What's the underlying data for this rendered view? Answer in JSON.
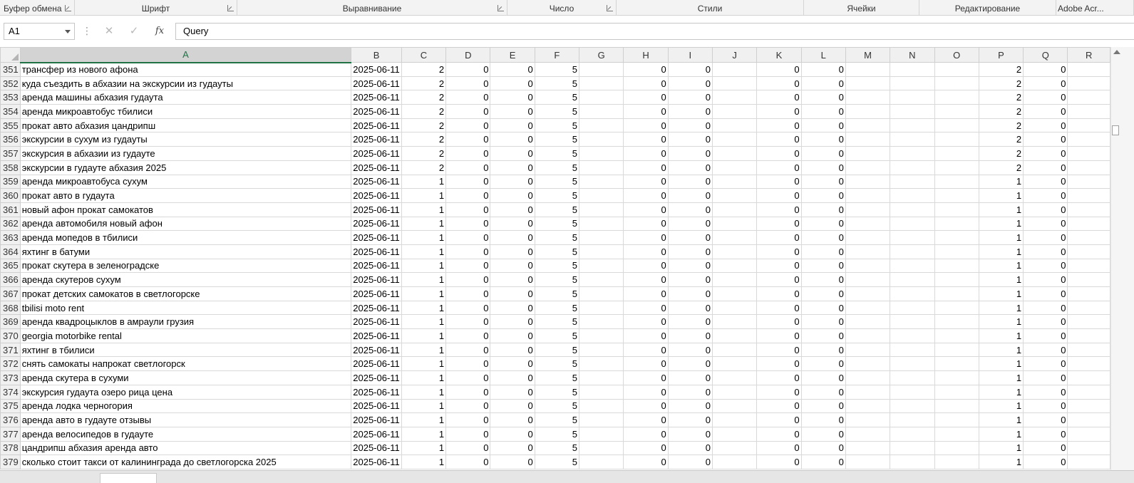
{
  "ribbon": {
    "groups": [
      {
        "label": "Буфер обмена",
        "launcher": true
      },
      {
        "label": "Шрифт",
        "launcher": true
      },
      {
        "label": "Выравнивание",
        "launcher": true
      },
      {
        "label": "Число",
        "launcher": true
      },
      {
        "label": "Стили",
        "launcher": false
      },
      {
        "label": "Ячейки",
        "launcher": false
      },
      {
        "label": "Редактирование",
        "launcher": false
      },
      {
        "label": "Adobe Acr...",
        "launcher": false
      }
    ]
  },
  "formula_bar": {
    "name_box": "A1",
    "cancel_icon": "✕",
    "enter_icon": "✓",
    "fx_label": "fx",
    "content": "Query"
  },
  "columns": [
    "A",
    "B",
    "C",
    "D",
    "E",
    "F",
    "G",
    "H",
    "I",
    "J",
    "K",
    "L",
    "M",
    "N",
    "O",
    "P",
    "Q",
    "R"
  ],
  "rows": [
    {
      "n": "351",
      "a": "трансфер из нового афона",
      "b": "2025-06-11",
      "c": "2",
      "d": "0",
      "e": "0",
      "f": "5",
      "g": "",
      "h": "0",
      "i": "0",
      "j": "",
      "k": "0",
      "l": "0",
      "m": "",
      "nn": "",
      "o": "",
      "p": "2",
      "q": "0",
      "r": ""
    },
    {
      "n": "352",
      "a": "куда съездить в абхазии на экскурсии из гудауты",
      "b": "2025-06-11",
      "c": "2",
      "d": "0",
      "e": "0",
      "f": "5",
      "g": "",
      "h": "0",
      "i": "0",
      "j": "",
      "k": "0",
      "l": "0",
      "m": "",
      "nn": "",
      "o": "",
      "p": "2",
      "q": "0",
      "r": ""
    },
    {
      "n": "353",
      "a": "аренда машины абхазия гудаута",
      "b": "2025-06-11",
      "c": "2",
      "d": "0",
      "e": "0",
      "f": "5",
      "g": "",
      "h": "0",
      "i": "0",
      "j": "",
      "k": "0",
      "l": "0",
      "m": "",
      "nn": "",
      "o": "",
      "p": "2",
      "q": "0",
      "r": ""
    },
    {
      "n": "354",
      "a": "аренда микроавтобус тбилиси",
      "b": "2025-06-11",
      "c": "2",
      "d": "0",
      "e": "0",
      "f": "5",
      "g": "",
      "h": "0",
      "i": "0",
      "j": "",
      "k": "0",
      "l": "0",
      "m": "",
      "nn": "",
      "o": "",
      "p": "2",
      "q": "0",
      "r": ""
    },
    {
      "n": "355",
      "a": "прокат авто абхазия цандрипш",
      "b": "2025-06-11",
      "c": "2",
      "d": "0",
      "e": "0",
      "f": "5",
      "g": "",
      "h": "0",
      "i": "0",
      "j": "",
      "k": "0",
      "l": "0",
      "m": "",
      "nn": "",
      "o": "",
      "p": "2",
      "q": "0",
      "r": ""
    },
    {
      "n": "356",
      "a": "экскурсии в сухум из гудауты",
      "b": "2025-06-11",
      "c": "2",
      "d": "0",
      "e": "0",
      "f": "5",
      "g": "",
      "h": "0",
      "i": "0",
      "j": "",
      "k": "0",
      "l": "0",
      "m": "",
      "nn": "",
      "o": "",
      "p": "2",
      "q": "0",
      "r": ""
    },
    {
      "n": "357",
      "a": "экскурсия в абхазии из гудауте",
      "b": "2025-06-11",
      "c": "2",
      "d": "0",
      "e": "0",
      "f": "5",
      "g": "",
      "h": "0",
      "i": "0",
      "j": "",
      "k": "0",
      "l": "0",
      "m": "",
      "nn": "",
      "o": "",
      "p": "2",
      "q": "0",
      "r": ""
    },
    {
      "n": "358",
      "a": "экскурсии в гудауте абхазия 2025",
      "b": "2025-06-11",
      "c": "2",
      "d": "0",
      "e": "0",
      "f": "5",
      "g": "",
      "h": "0",
      "i": "0",
      "j": "",
      "k": "0",
      "l": "0",
      "m": "",
      "nn": "",
      "o": "",
      "p": "2",
      "q": "0",
      "r": ""
    },
    {
      "n": "359",
      "a": "аренда микроавтобуса сухум",
      "b": "2025-06-11",
      "c": "1",
      "d": "0",
      "e": "0",
      "f": "5",
      "g": "",
      "h": "0",
      "i": "0",
      "j": "",
      "k": "0",
      "l": "0",
      "m": "",
      "nn": "",
      "o": "",
      "p": "1",
      "q": "0",
      "r": ""
    },
    {
      "n": "360",
      "a": "прокат авто в гудаута",
      "b": "2025-06-11",
      "c": "1",
      "d": "0",
      "e": "0",
      "f": "5",
      "g": "",
      "h": "0",
      "i": "0",
      "j": "",
      "k": "0",
      "l": "0",
      "m": "",
      "nn": "",
      "o": "",
      "p": "1",
      "q": "0",
      "r": ""
    },
    {
      "n": "361",
      "a": "новый афон прокат самокатов",
      "b": "2025-06-11",
      "c": "1",
      "d": "0",
      "e": "0",
      "f": "5",
      "g": "",
      "h": "0",
      "i": "0",
      "j": "",
      "k": "0",
      "l": "0",
      "m": "",
      "nn": "",
      "o": "",
      "p": "1",
      "q": "0",
      "r": ""
    },
    {
      "n": "362",
      "a": "аренда автомобиля новый афон",
      "b": "2025-06-11",
      "c": "1",
      "d": "0",
      "e": "0",
      "f": "5",
      "g": "",
      "h": "0",
      "i": "0",
      "j": "",
      "k": "0",
      "l": "0",
      "m": "",
      "nn": "",
      "o": "",
      "p": "1",
      "q": "0",
      "r": ""
    },
    {
      "n": "363",
      "a": "аренда мопедов в тбилиси",
      "b": "2025-06-11",
      "c": "1",
      "d": "0",
      "e": "0",
      "f": "5",
      "g": "",
      "h": "0",
      "i": "0",
      "j": "",
      "k": "0",
      "l": "0",
      "m": "",
      "nn": "",
      "o": "",
      "p": "1",
      "q": "0",
      "r": ""
    },
    {
      "n": "364",
      "a": "яхтинг в батуми",
      "b": "2025-06-11",
      "c": "1",
      "d": "0",
      "e": "0",
      "f": "5",
      "g": "",
      "h": "0",
      "i": "0",
      "j": "",
      "k": "0",
      "l": "0",
      "m": "",
      "nn": "",
      "o": "",
      "p": "1",
      "q": "0",
      "r": ""
    },
    {
      "n": "365",
      "a": "прокат скутера в зеленоградске",
      "b": "2025-06-11",
      "c": "1",
      "d": "0",
      "e": "0",
      "f": "5",
      "g": "",
      "h": "0",
      "i": "0",
      "j": "",
      "k": "0",
      "l": "0",
      "m": "",
      "nn": "",
      "o": "",
      "p": "1",
      "q": "0",
      "r": ""
    },
    {
      "n": "366",
      "a": "аренда скутеров сухум",
      "b": "2025-06-11",
      "c": "1",
      "d": "0",
      "e": "0",
      "f": "5",
      "g": "",
      "h": "0",
      "i": "0",
      "j": "",
      "k": "0",
      "l": "0",
      "m": "",
      "nn": "",
      "o": "",
      "p": "1",
      "q": "0",
      "r": ""
    },
    {
      "n": "367",
      "a": "прокат детских самокатов в светлогорске",
      "b": "2025-06-11",
      "c": "1",
      "d": "0",
      "e": "0",
      "f": "5",
      "g": "",
      "h": "0",
      "i": "0",
      "j": "",
      "k": "0",
      "l": "0",
      "m": "",
      "nn": "",
      "o": "",
      "p": "1",
      "q": "0",
      "r": ""
    },
    {
      "n": "368",
      "a": "tbilisi moto rent",
      "b": "2025-06-11",
      "c": "1",
      "d": "0",
      "e": "0",
      "f": "5",
      "g": "",
      "h": "0",
      "i": "0",
      "j": "",
      "k": "0",
      "l": "0",
      "m": "",
      "nn": "",
      "o": "",
      "p": "1",
      "q": "0",
      "r": ""
    },
    {
      "n": "369",
      "a": "аренда квадроцыклов в амраули грузия",
      "b": "2025-06-11",
      "c": "1",
      "d": "0",
      "e": "0",
      "f": "5",
      "g": "",
      "h": "0",
      "i": "0",
      "j": "",
      "k": "0",
      "l": "0",
      "m": "",
      "nn": "",
      "o": "",
      "p": "1",
      "q": "0",
      "r": ""
    },
    {
      "n": "370",
      "a": "georgia motorbike rental",
      "b": "2025-06-11",
      "c": "1",
      "d": "0",
      "e": "0",
      "f": "5",
      "g": "",
      "h": "0",
      "i": "0",
      "j": "",
      "k": "0",
      "l": "0",
      "m": "",
      "nn": "",
      "o": "",
      "p": "1",
      "q": "0",
      "r": ""
    },
    {
      "n": "371",
      "a": "яхтинг в тбилиси",
      "b": "2025-06-11",
      "c": "1",
      "d": "0",
      "e": "0",
      "f": "5",
      "g": "",
      "h": "0",
      "i": "0",
      "j": "",
      "k": "0",
      "l": "0",
      "m": "",
      "nn": "",
      "o": "",
      "p": "1",
      "q": "0",
      "r": ""
    },
    {
      "n": "372",
      "a": "снять самокаты напрокат светлогорск",
      "b": "2025-06-11",
      "c": "1",
      "d": "0",
      "e": "0",
      "f": "5",
      "g": "",
      "h": "0",
      "i": "0",
      "j": "",
      "k": "0",
      "l": "0",
      "m": "",
      "nn": "",
      "o": "",
      "p": "1",
      "q": "0",
      "r": ""
    },
    {
      "n": "373",
      "a": "аренда скутера в сухуми",
      "b": "2025-06-11",
      "c": "1",
      "d": "0",
      "e": "0",
      "f": "5",
      "g": "",
      "h": "0",
      "i": "0",
      "j": "",
      "k": "0",
      "l": "0",
      "m": "",
      "nn": "",
      "o": "",
      "p": "1",
      "q": "0",
      "r": ""
    },
    {
      "n": "374",
      "a": "экскурсия гудаута озеро рица цена",
      "b": "2025-06-11",
      "c": "1",
      "d": "0",
      "e": "0",
      "f": "5",
      "g": "",
      "h": "0",
      "i": "0",
      "j": "",
      "k": "0",
      "l": "0",
      "m": "",
      "nn": "",
      "o": "",
      "p": "1",
      "q": "0",
      "r": ""
    },
    {
      "n": "375",
      "a": "аренда лодка черногория",
      "b": "2025-06-11",
      "c": "1",
      "d": "0",
      "e": "0",
      "f": "5",
      "g": "",
      "h": "0",
      "i": "0",
      "j": "",
      "k": "0",
      "l": "0",
      "m": "",
      "nn": "",
      "o": "",
      "p": "1",
      "q": "0",
      "r": ""
    },
    {
      "n": "376",
      "a": "аренда авто в гудауте отзывы",
      "b": "2025-06-11",
      "c": "1",
      "d": "0",
      "e": "0",
      "f": "5",
      "g": "",
      "h": "0",
      "i": "0",
      "j": "",
      "k": "0",
      "l": "0",
      "m": "",
      "nn": "",
      "o": "",
      "p": "1",
      "q": "0",
      "r": ""
    },
    {
      "n": "377",
      "a": "аренда велосипедов в гудауте",
      "b": "2025-06-11",
      "c": "1",
      "d": "0",
      "e": "0",
      "f": "5",
      "g": "",
      "h": "0",
      "i": "0",
      "j": "",
      "k": "0",
      "l": "0",
      "m": "",
      "nn": "",
      "o": "",
      "p": "1",
      "q": "0",
      "r": ""
    },
    {
      "n": "378",
      "a": "цандрипш абхазия аренда авто",
      "b": "2025-06-11",
      "c": "1",
      "d": "0",
      "e": "0",
      "f": "5",
      "g": "",
      "h": "0",
      "i": "0",
      "j": "",
      "k": "0",
      "l": "0",
      "m": "",
      "nn": "",
      "o": "",
      "p": "1",
      "q": "0",
      "r": ""
    },
    {
      "n": "379",
      "a": "сколько стоит такси от калининграда до светлогорска 2025",
      "b": "2025-06-11",
      "c": "1",
      "d": "0",
      "e": "0",
      "f": "5",
      "g": "",
      "h": "0",
      "i": "0",
      "j": "",
      "k": "0",
      "l": "0",
      "m": "",
      "nn": "",
      "o": "",
      "p": "1",
      "q": "0",
      "r": ""
    }
  ]
}
